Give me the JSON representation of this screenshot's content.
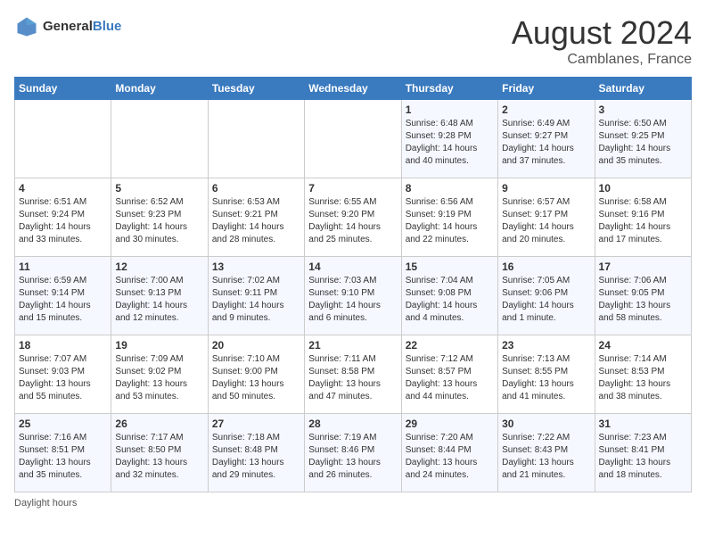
{
  "header": {
    "logo_general": "General",
    "logo_blue": "Blue",
    "title": "August 2024",
    "location": "Camblanes, France"
  },
  "days_of_week": [
    "Sunday",
    "Monday",
    "Tuesday",
    "Wednesday",
    "Thursday",
    "Friday",
    "Saturday"
  ],
  "weeks": [
    [
      {
        "day": "",
        "info": ""
      },
      {
        "day": "",
        "info": ""
      },
      {
        "day": "",
        "info": ""
      },
      {
        "day": "",
        "info": ""
      },
      {
        "day": "1",
        "info": "Sunrise: 6:48 AM\nSunset: 9:28 PM\nDaylight: 14 hours\nand 40 minutes."
      },
      {
        "day": "2",
        "info": "Sunrise: 6:49 AM\nSunset: 9:27 PM\nDaylight: 14 hours\nand 37 minutes."
      },
      {
        "day": "3",
        "info": "Sunrise: 6:50 AM\nSunset: 9:25 PM\nDaylight: 14 hours\nand 35 minutes."
      }
    ],
    [
      {
        "day": "4",
        "info": "Sunrise: 6:51 AM\nSunset: 9:24 PM\nDaylight: 14 hours\nand 33 minutes."
      },
      {
        "day": "5",
        "info": "Sunrise: 6:52 AM\nSunset: 9:23 PM\nDaylight: 14 hours\nand 30 minutes."
      },
      {
        "day": "6",
        "info": "Sunrise: 6:53 AM\nSunset: 9:21 PM\nDaylight: 14 hours\nand 28 minutes."
      },
      {
        "day": "7",
        "info": "Sunrise: 6:55 AM\nSunset: 9:20 PM\nDaylight: 14 hours\nand 25 minutes."
      },
      {
        "day": "8",
        "info": "Sunrise: 6:56 AM\nSunset: 9:19 PM\nDaylight: 14 hours\nand 22 minutes."
      },
      {
        "day": "9",
        "info": "Sunrise: 6:57 AM\nSunset: 9:17 PM\nDaylight: 14 hours\nand 20 minutes."
      },
      {
        "day": "10",
        "info": "Sunrise: 6:58 AM\nSunset: 9:16 PM\nDaylight: 14 hours\nand 17 minutes."
      }
    ],
    [
      {
        "day": "11",
        "info": "Sunrise: 6:59 AM\nSunset: 9:14 PM\nDaylight: 14 hours\nand 15 minutes."
      },
      {
        "day": "12",
        "info": "Sunrise: 7:00 AM\nSunset: 9:13 PM\nDaylight: 14 hours\nand 12 minutes."
      },
      {
        "day": "13",
        "info": "Sunrise: 7:02 AM\nSunset: 9:11 PM\nDaylight: 14 hours\nand 9 minutes."
      },
      {
        "day": "14",
        "info": "Sunrise: 7:03 AM\nSunset: 9:10 PM\nDaylight: 14 hours\nand 6 minutes."
      },
      {
        "day": "15",
        "info": "Sunrise: 7:04 AM\nSunset: 9:08 PM\nDaylight: 14 hours\nand 4 minutes."
      },
      {
        "day": "16",
        "info": "Sunrise: 7:05 AM\nSunset: 9:06 PM\nDaylight: 14 hours\nand 1 minute."
      },
      {
        "day": "17",
        "info": "Sunrise: 7:06 AM\nSunset: 9:05 PM\nDaylight: 13 hours\nand 58 minutes."
      }
    ],
    [
      {
        "day": "18",
        "info": "Sunrise: 7:07 AM\nSunset: 9:03 PM\nDaylight: 13 hours\nand 55 minutes."
      },
      {
        "day": "19",
        "info": "Sunrise: 7:09 AM\nSunset: 9:02 PM\nDaylight: 13 hours\nand 53 minutes."
      },
      {
        "day": "20",
        "info": "Sunrise: 7:10 AM\nSunset: 9:00 PM\nDaylight: 13 hours\nand 50 minutes."
      },
      {
        "day": "21",
        "info": "Sunrise: 7:11 AM\nSunset: 8:58 PM\nDaylight: 13 hours\nand 47 minutes."
      },
      {
        "day": "22",
        "info": "Sunrise: 7:12 AM\nSunset: 8:57 PM\nDaylight: 13 hours\nand 44 minutes."
      },
      {
        "day": "23",
        "info": "Sunrise: 7:13 AM\nSunset: 8:55 PM\nDaylight: 13 hours\nand 41 minutes."
      },
      {
        "day": "24",
        "info": "Sunrise: 7:14 AM\nSunset: 8:53 PM\nDaylight: 13 hours\nand 38 minutes."
      }
    ],
    [
      {
        "day": "25",
        "info": "Sunrise: 7:16 AM\nSunset: 8:51 PM\nDaylight: 13 hours\nand 35 minutes."
      },
      {
        "day": "26",
        "info": "Sunrise: 7:17 AM\nSunset: 8:50 PM\nDaylight: 13 hours\nand 32 minutes."
      },
      {
        "day": "27",
        "info": "Sunrise: 7:18 AM\nSunset: 8:48 PM\nDaylight: 13 hours\nand 29 minutes."
      },
      {
        "day": "28",
        "info": "Sunrise: 7:19 AM\nSunset: 8:46 PM\nDaylight: 13 hours\nand 26 minutes."
      },
      {
        "day": "29",
        "info": "Sunrise: 7:20 AM\nSunset: 8:44 PM\nDaylight: 13 hours\nand 24 minutes."
      },
      {
        "day": "30",
        "info": "Sunrise: 7:22 AM\nSunset: 8:43 PM\nDaylight: 13 hours\nand 21 minutes."
      },
      {
        "day": "31",
        "info": "Sunrise: 7:23 AM\nSunset: 8:41 PM\nDaylight: 13 hours\nand 18 minutes."
      }
    ]
  ],
  "footer": {
    "note": "Daylight hours"
  }
}
